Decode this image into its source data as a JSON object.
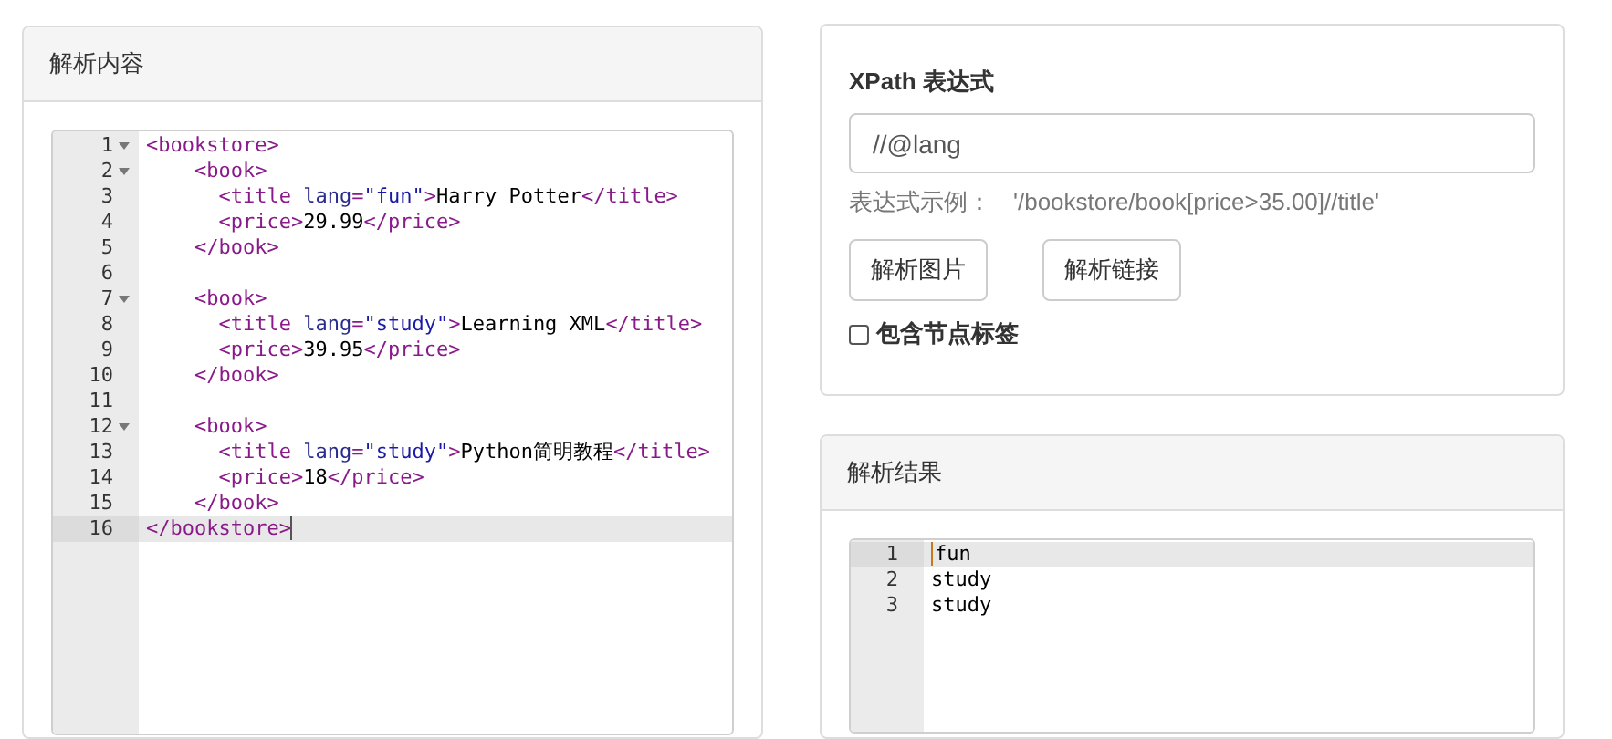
{
  "left_panel": {
    "title": "解析内容",
    "editor": {
      "lines": [
        {
          "number": "1",
          "foldable": true,
          "active": false,
          "tokens": [
            {
              "kind": "tag",
              "text": "<bookstore>"
            }
          ]
        },
        {
          "number": "2",
          "foldable": true,
          "active": false,
          "tokens": [
            {
              "kind": "tag",
              "text": "    <book>"
            }
          ]
        },
        {
          "number": "3",
          "foldable": false,
          "active": false,
          "tokens": [
            {
              "kind": "tag",
              "text": "      <title "
            },
            {
              "kind": "attr",
              "text": "lang"
            },
            {
              "kind": "tag",
              "text": "="
            },
            {
              "kind": "value",
              "text": "\"fun\""
            },
            {
              "kind": "tag",
              "text": ">"
            },
            {
              "kind": "text",
              "text": "Harry Potter"
            },
            {
              "kind": "tag",
              "text": "</title>"
            }
          ]
        },
        {
          "number": "4",
          "foldable": false,
          "active": false,
          "tokens": [
            {
              "kind": "tag",
              "text": "      <price>"
            },
            {
              "kind": "text",
              "text": "29.99"
            },
            {
              "kind": "tag",
              "text": "</price>"
            }
          ]
        },
        {
          "number": "5",
          "foldable": false,
          "active": false,
          "tokens": [
            {
              "kind": "tag",
              "text": "    </book>"
            }
          ]
        },
        {
          "number": "6",
          "foldable": false,
          "active": false
        },
        {
          "number": "7",
          "foldable": true,
          "active": false,
          "tokens": [
            {
              "kind": "tag",
              "text": "    <book>"
            }
          ]
        },
        {
          "number": "8",
          "foldable": false,
          "active": false,
          "tokens": [
            {
              "kind": "tag",
              "text": "      <title "
            },
            {
              "kind": "attr",
              "text": "lang"
            },
            {
              "kind": "tag",
              "text": "="
            },
            {
              "kind": "value",
              "text": "\"study\""
            },
            {
              "kind": "tag",
              "text": ">"
            },
            {
              "kind": "text",
              "text": "Learning XML"
            },
            {
              "kind": "tag",
              "text": "</title>"
            }
          ]
        },
        {
          "number": "9",
          "foldable": false,
          "active": false,
          "tokens": [
            {
              "kind": "tag",
              "text": "      <price>"
            },
            {
              "kind": "text",
              "text": "39.95"
            },
            {
              "kind": "tag",
              "text": "</price>"
            }
          ]
        },
        {
          "number": "10",
          "foldable": false,
          "active": false,
          "tokens": [
            {
              "kind": "tag",
              "text": "    </book>"
            }
          ]
        },
        {
          "number": "11",
          "foldable": false,
          "active": false
        },
        {
          "number": "12",
          "foldable": true,
          "active": false,
          "tokens": [
            {
              "kind": "tag",
              "text": "    <book>"
            }
          ]
        },
        {
          "number": "13",
          "foldable": false,
          "active": false,
          "tokens": [
            {
              "kind": "tag",
              "text": "      <title "
            },
            {
              "kind": "attr",
              "text": "lang"
            },
            {
              "kind": "tag",
              "text": "="
            },
            {
              "kind": "value",
              "text": "\"study\""
            },
            {
              "kind": "tag",
              "text": ">"
            },
            {
              "kind": "text",
              "text": "Python简明教程"
            },
            {
              "kind": "tag",
              "text": "</title>"
            }
          ]
        },
        {
          "number": "14",
          "foldable": false,
          "active": false,
          "tokens": [
            {
              "kind": "tag",
              "text": "      <price>"
            },
            {
              "kind": "text",
              "text": "18"
            },
            {
              "kind": "tag",
              "text": "</price>"
            }
          ]
        },
        {
          "number": "15",
          "foldable": false,
          "active": false,
          "tokens": [
            {
              "kind": "tag",
              "text": "    </book>"
            }
          ]
        },
        {
          "number": "16",
          "foldable": false,
          "active": true,
          "tokens": [
            {
              "kind": "tag",
              "text": "</bookstore>"
            }
          ]
        }
      ]
    }
  },
  "xpath_panel": {
    "label": "XPath 表达式",
    "input": {
      "value": "//@lang"
    },
    "hint": "表达式示例：",
    "example": "'/bookstore/book[price>35.00]//title'",
    "buttons": [
      "解析图片",
      "解析链接"
    ],
    "checkbox": {
      "label": "包含节点标签",
      "checked": false
    }
  },
  "result_panel": {
    "title": "解析结果",
    "editor": {
      "lines": [
        {
          "number": "1",
          "foldable": false,
          "active": true,
          "tokens": [
            {
              "kind": "text",
              "text": "fun"
            }
          ]
        },
        {
          "number": "2",
          "foldable": false,
          "active": false,
          "tokens": [
            {
              "kind": "text",
              "text": "study"
            }
          ]
        },
        {
          "number": "3",
          "foldable": false,
          "active": false,
          "tokens": [
            {
              "kind": "text",
              "text": "study"
            }
          ]
        }
      ]
    }
  }
}
